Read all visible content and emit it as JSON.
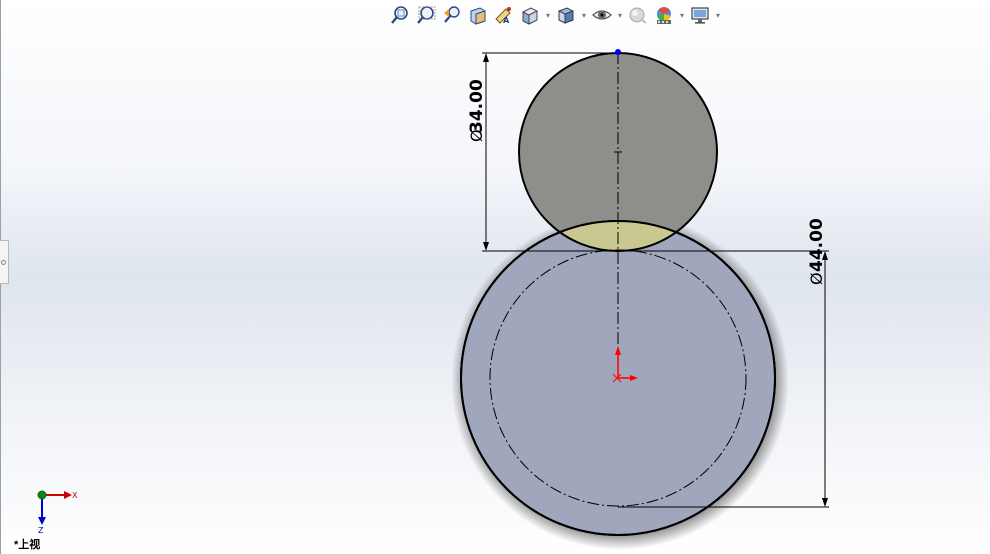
{
  "toolbar": {
    "items": [
      {
        "name": "zoom-to-fit-icon",
        "dropdown": false
      },
      {
        "name": "zoom-to-area-icon",
        "dropdown": false
      },
      {
        "name": "previous-view-icon",
        "dropdown": false
      },
      {
        "name": "section-view-icon",
        "dropdown": false
      },
      {
        "name": "dynamic-annotation-icon",
        "dropdown": false
      },
      {
        "name": "view-orientation-icon",
        "dropdown": true
      },
      {
        "name": "display-style-icon",
        "dropdown": true
      },
      {
        "name": "hide-show-items-icon",
        "dropdown": true
      },
      {
        "name": "edit-appearance-icon",
        "dropdown": false
      },
      {
        "name": "apply-scene-icon",
        "dropdown": true
      },
      {
        "name": "view-settings-icon",
        "dropdown": true
      }
    ]
  },
  "dimensions": {
    "small_circle_diameter": "34.00",
    "large_circle_diameter": "44.00"
  },
  "triad": {
    "x_label": "X",
    "z_label": "Z"
  },
  "view": {
    "name": "*上视"
  },
  "colors": {
    "small_circle_fill": "#8e8f8b",
    "large_circle_fill": "#a0a6bc",
    "overlap_fill": "#c9c891",
    "origin": "#ff0000",
    "point": "#0000ff"
  }
}
